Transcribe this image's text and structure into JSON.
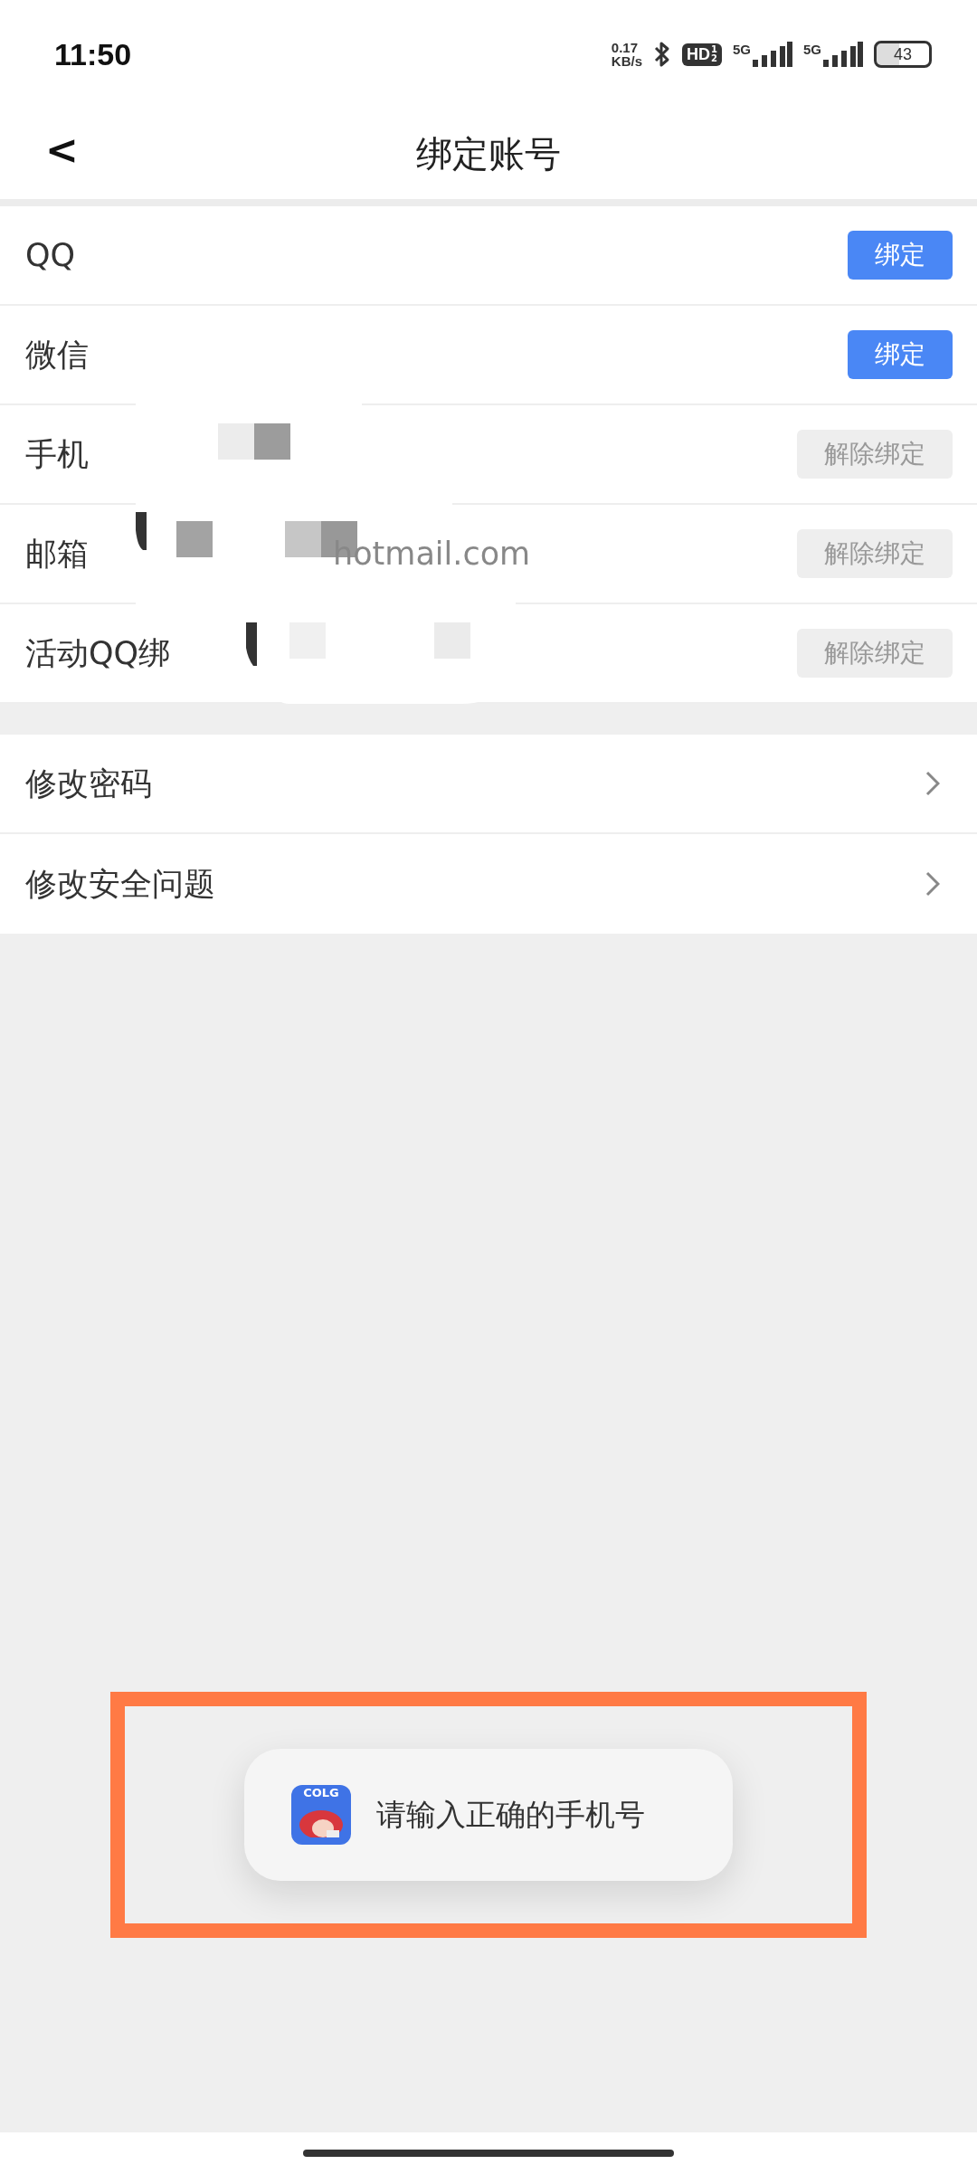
{
  "status_bar": {
    "time": "11:50",
    "net_speed": [
      "0.17",
      "KB/s"
    ],
    "hd_badge": {
      "label": "HD",
      "fraction": [
        "1",
        "2"
      ]
    },
    "sims": [
      {
        "label": "5G"
      },
      {
        "label": "5G"
      }
    ],
    "battery": "43"
  },
  "header": {
    "back": "<",
    "title": "绑定账号"
  },
  "bindings": [
    {
      "label": "QQ",
      "button": "绑定",
      "bound": false
    },
    {
      "label": "微信",
      "button": "绑定",
      "bound": false
    },
    {
      "label": "手机",
      "button": "解除绑定",
      "bound": true
    },
    {
      "label": "邮箱",
      "value": "hotmail.com",
      "button": "解除绑定",
      "bound": true
    },
    {
      "label": "活动QQ绑",
      "button": "解除绑定",
      "bound": true
    }
  ],
  "settings": [
    {
      "label": "修改密码"
    },
    {
      "label": "修改安全问题"
    }
  ],
  "toast": {
    "app_icon_label": "COLG",
    "message": "请输入正确的手机号"
  }
}
